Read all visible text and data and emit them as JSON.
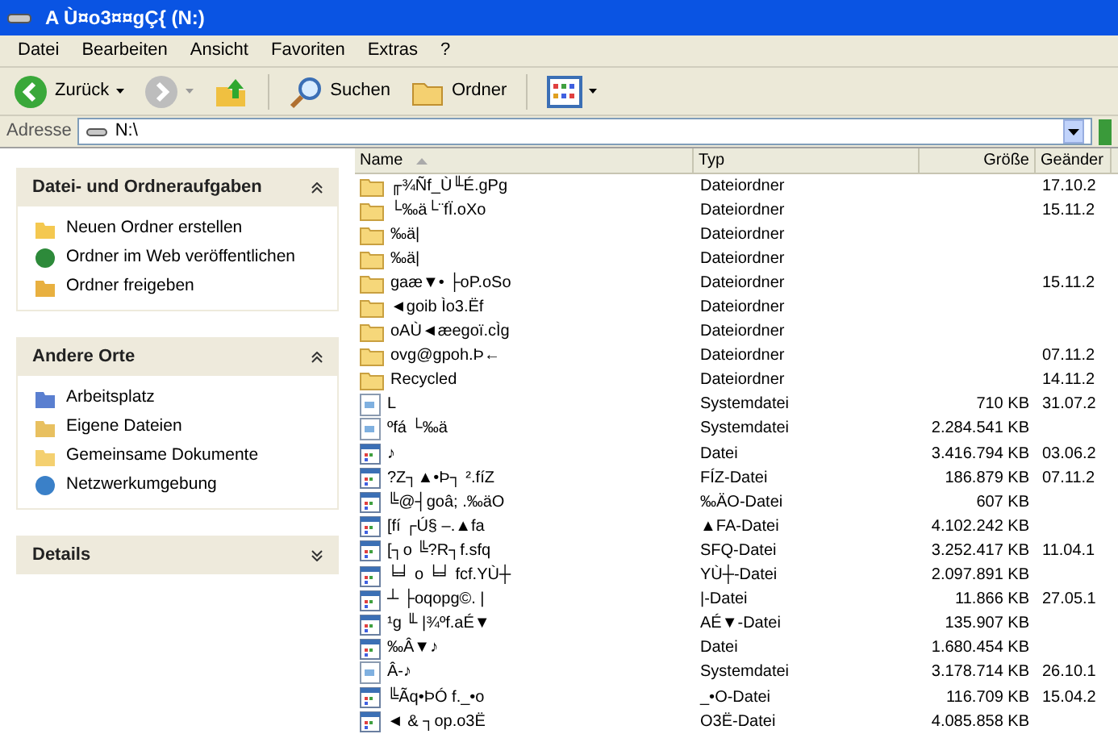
{
  "window": {
    "title": "A Ù¤o3¤¤gÇ{ (N:)"
  },
  "menu": [
    "Datei",
    "Bearbeiten",
    "Ansicht",
    "Favoriten",
    "Extras",
    "?"
  ],
  "toolbar": [
    {
      "kind": "back",
      "label": "Zurück"
    },
    {
      "kind": "forward"
    },
    {
      "kind": "up"
    },
    {
      "kind": "search",
      "label": "Suchen"
    },
    {
      "kind": "folders",
      "label": "Ordner"
    },
    {
      "kind": "views"
    }
  ],
  "address": {
    "label": "Adresse",
    "value": "N:\\"
  },
  "panels": [
    {
      "title": "Datei- und Ordneraufgaben",
      "expanded": true,
      "items": [
        {
          "kind": "newfolder",
          "label": "Neuen Ordner erstellen"
        },
        {
          "kind": "web",
          "label": "Ordner im Web veröffentlichen"
        },
        {
          "kind": "share",
          "label": "Ordner freigeben"
        }
      ]
    },
    {
      "title": "Andere Orte",
      "expanded": true,
      "items": [
        {
          "kind": "computer",
          "label": "Arbeitsplatz"
        },
        {
          "kind": "documents",
          "label": "Eigene Dateien"
        },
        {
          "kind": "folder",
          "label": "Gemeinsame Dokumente"
        },
        {
          "kind": "network",
          "label": "Netzwerkumgebung"
        }
      ]
    },
    {
      "title": "Details",
      "expanded": false
    }
  ],
  "table": {
    "columns": [
      "Name",
      "Typ",
      "Größe",
      "Geänder"
    ],
    "rows": [
      {
        "kind": "folder",
        "name": "╓¾Ñf_Ù╙É.gPg",
        "type": "Dateiordner",
        "size": "",
        "date": "17.10.2"
      },
      {
        "kind": "folder",
        "name": "└‰ä└¨fÏ.oXo",
        "type": "Dateiordner",
        "size": "",
        "date": "15.11.2"
      },
      {
        "kind": "folder",
        "name": "‰ä|",
        "type": "Dateiordner",
        "size": "",
        "date": ""
      },
      {
        "kind": "folder",
        "name": "‰ä|",
        "type": "Dateiordner",
        "size": "",
        "date": ""
      },
      {
        "kind": "folder",
        "name": "gaæ▼• ├oP.oSo",
        "type": "Dateiordner",
        "size": "",
        "date": "15.11.2"
      },
      {
        "kind": "folder",
        "name": "◄goib Ìo3.Ëf",
        "type": "Dateiordner",
        "size": "",
        "date": ""
      },
      {
        "kind": "folder",
        "name": "oAÙ◄æegoï.cÌg",
        "type": "Dateiordner",
        "size": "",
        "date": ""
      },
      {
        "kind": "folder",
        "name": "ovg@gpoh.Þ←",
        "type": "Dateiordner",
        "size": "",
        "date": "07.11.2"
      },
      {
        "kind": "folder",
        "name": "Recycled",
        "type": "Dateiordner",
        "size": "",
        "date": "14.11.2"
      },
      {
        "kind": "system",
        "name": "L",
        "type": "Systemdatei",
        "size": "710 KB",
        "date": "31.07.2"
      },
      {
        "kind": "system",
        "name": "ºfá └‰ä",
        "type": "Systemdatei",
        "size": "2.284.541 KB",
        "date": ""
      },
      {
        "kind": "file",
        "name": "♪",
        "type": "Datei",
        "size": "3.416.794 KB",
        "date": "03.06.2"
      },
      {
        "kind": "file",
        "name": "?Z┐▲•Þ┐ ².fíZ",
        "type": "FÍZ-Datei",
        "size": "186.879 KB",
        "date": "07.11.2"
      },
      {
        "kind": "file",
        "name": "╚@┤goâ; .‰äO",
        "type": "‰ÄO-Datei",
        "size": "607 KB",
        "date": ""
      },
      {
        "kind": "file",
        "name": "[fí ┌Ú§ –.▲fa",
        "type": "▲FA-Datei",
        "size": "4.102.242 KB",
        "date": ""
      },
      {
        "kind": "file",
        "name": "[┐o ╚?R┐f.sfq",
        "type": "SFQ-Datei",
        "size": "3.252.417 KB",
        "date": "11.04.1"
      },
      {
        "kind": "file",
        "name": "╘╛ o ╘╛ fcf.YÙ┼",
        "type": "YÙ┼-Datei",
        "size": "2.097.891 KB",
        "date": ""
      },
      {
        "kind": "file",
        "name": "┴ ├oqopg©. |",
        "type": "|-Datei",
        "size": "11.866 KB",
        "date": "27.05.1"
      },
      {
        "kind": "file",
        "name": "¹g ╙ |¾ºf.aÉ▼",
        "type": "AÉ▼-Datei",
        "size": "135.907 KB",
        "date": ""
      },
      {
        "kind": "file",
        "name": "‰Â▼♪",
        "type": "Datei",
        "size": "1.680.454 KB",
        "date": ""
      },
      {
        "kind": "system",
        "name": "Â-♪",
        "type": "Systemdatei",
        "size": "3.178.714 KB",
        "date": "26.10.1"
      },
      {
        "kind": "file",
        "name": "╚Ãq•ÞÓ f._•o",
        "type": "_•O-Datei",
        "size": "116.709 KB",
        "date": "15.04.2"
      },
      {
        "kind": "file",
        "name": "◄ & ┐op.o3Ë",
        "type": "O3Ë-Datei",
        "size": "4.085.858 KB",
        "date": ""
      }
    ]
  }
}
